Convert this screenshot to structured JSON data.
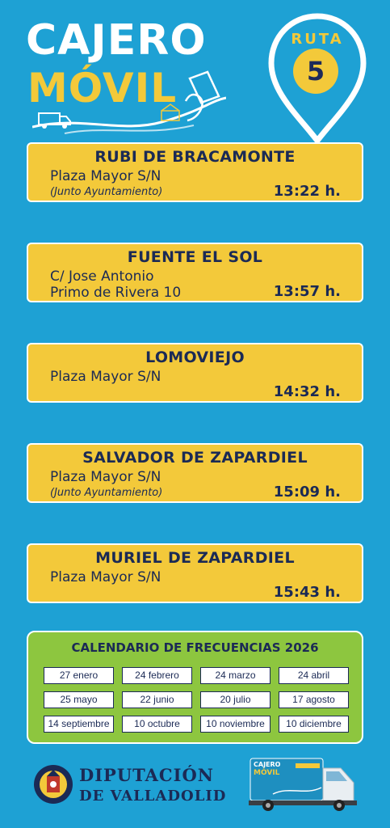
{
  "header": {
    "title_line1": "CAJERO",
    "title_line2": "MÓVIL",
    "route_label": "RUTA",
    "route_number": "5"
  },
  "colors": {
    "background": "#1ea1d4",
    "card": "#f3c93a",
    "calendar": "#8dc63f",
    "text_dark": "#1b2a55"
  },
  "stops": [
    {
      "name": "RUBI DE BRACAMONTE",
      "address1": "Plaza Mayor S/N",
      "address2": "",
      "note": "(Junto Ayuntamiento)",
      "time": "13:22 h."
    },
    {
      "name": "FUENTE EL SOL",
      "address1": "C/ Jose Antonio",
      "address2": "Primo de Rivera 10",
      "note": "",
      "time": "13:57 h."
    },
    {
      "name": "LOMOVIEJO",
      "address1": "Plaza Mayor S/N",
      "address2": "",
      "note": "",
      "time": "14:32 h."
    },
    {
      "name": "SALVADOR DE ZAPARDIEL",
      "address1": "Plaza Mayor S/N",
      "address2": "",
      "note": "(Junto Ayuntamiento)",
      "time": "15:09 h."
    },
    {
      "name": "MURIEL DE ZAPARDIEL",
      "address1": "Plaza Mayor S/N",
      "address2": "",
      "note": "",
      "time": "15:43 h."
    }
  ],
  "calendar": {
    "title": "CALENDARIO DE FRECUENCIAS 2026",
    "dates": [
      "27 enero",
      "24 febrero",
      "24 marzo",
      "24 abril",
      "25 mayo",
      "22 junio",
      "20 julio",
      "17 agosto",
      "14 septiembre",
      "10 octubre",
      "10 noviembre",
      "10 diciembre"
    ]
  },
  "footer": {
    "org_line1": "DIPUTACIÓN",
    "org_line2": "DE VALLADOLID",
    "truck_label1": "CAJERO",
    "truck_label2": "MÓVIL"
  }
}
